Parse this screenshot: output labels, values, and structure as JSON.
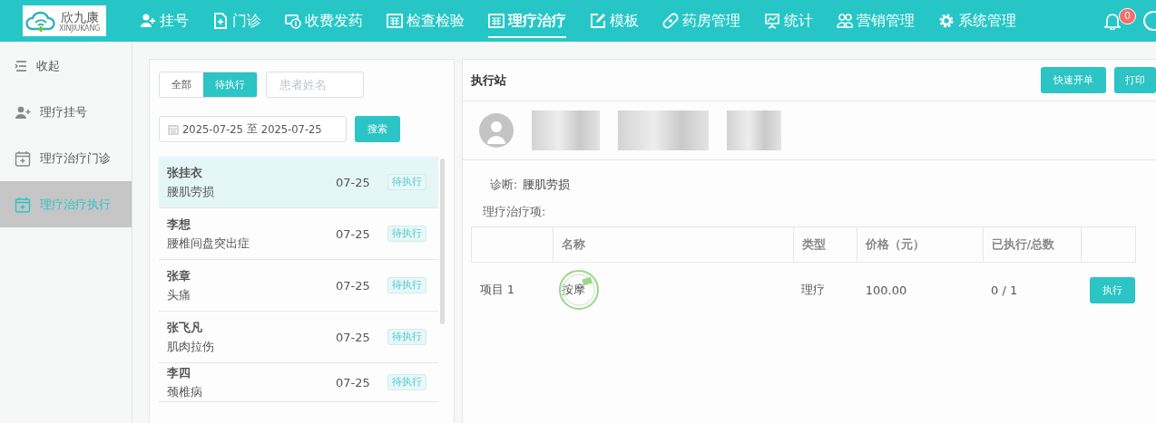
{
  "header": {
    "logo": {
      "name": "欣九康",
      "subtitle": "XINJIUKANG"
    },
    "nav": [
      {
        "label": "挂号",
        "selected": false
      },
      {
        "label": "门诊",
        "selected": false
      },
      {
        "label": "收费发药",
        "selected": false
      },
      {
        "label": "检查检验",
        "selected": false
      },
      {
        "label": "理疗治疗",
        "selected": true
      },
      {
        "label": "模板",
        "selected": false
      },
      {
        "label": "药房管理",
        "selected": false
      },
      {
        "label": "统计",
        "selected": false
      },
      {
        "label": "营销管理",
        "selected": false
      },
      {
        "label": "系统管理",
        "selected": false
      }
    ],
    "notification_count": "0"
  },
  "sidebar": {
    "collapse_label": "收起",
    "items": [
      {
        "label": "理疗挂号",
        "selected": false
      },
      {
        "label": "理疗治疗门诊",
        "selected": false
      },
      {
        "label": "理疗治疗执行",
        "selected": true
      }
    ]
  },
  "patient_list": {
    "filters": [
      {
        "label": "全部",
        "selected": false
      },
      {
        "label": "待执行",
        "selected": true
      }
    ],
    "search": {
      "placeholder": "患者姓名"
    },
    "date_range": {
      "start": "2025-07-25",
      "separator": "至",
      "end": "2025-07-25"
    },
    "search_button": "搜索",
    "patients": [
      {
        "name": "张挂衣",
        "diagnosis": "腰肌劳损",
        "date": "07-25",
        "status": "待执行",
        "selected": true
      },
      {
        "name": "李想",
        "diagnosis": "腰椎间盘突出症",
        "date": "07-25",
        "status": "待执行",
        "selected": false
      },
      {
        "name": "张章",
        "diagnosis": "头痛",
        "date": "07-25",
        "status": "待执行",
        "selected": false
      },
      {
        "name": "张飞凡",
        "diagnosis": "肌肉拉伤",
        "date": "07-25",
        "status": "待执行",
        "selected": false
      },
      {
        "name": "李四",
        "diagnosis": "颈椎病",
        "date": "07-25",
        "status": "待执行",
        "selected": false
      }
    ]
  },
  "detail": {
    "title": "执行站",
    "buttons": [
      "快速开单",
      "打印"
    ],
    "diagnosis_label": "诊断:",
    "diagnosis": "腰肌劳损",
    "items_label": "理疗治疗项:",
    "table": {
      "columns": [
        "名称",
        "类型",
        "价格（元）",
        "已执行/总数"
      ],
      "rows": [
        {
          "column_1": "项目 1",
          "name": "按摩",
          "stamped": true,
          "type": "理疗",
          "price": "100.00",
          "progress": "0 / 1",
          "action": "执行"
        }
      ]
    }
  }
}
